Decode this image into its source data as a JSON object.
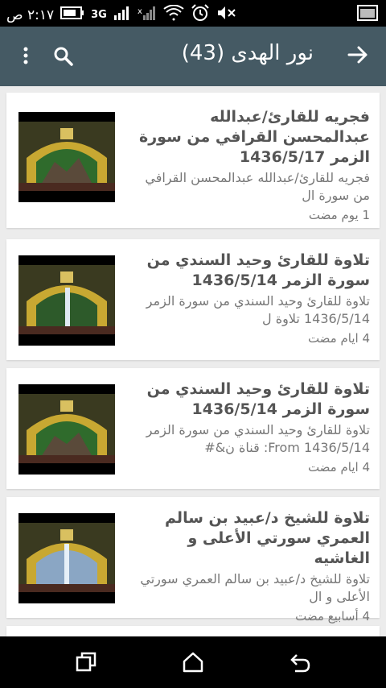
{
  "status": {
    "time": "٢:١٧ ص",
    "network_label": "3G"
  },
  "appbar": {
    "title": "نور الهدى (43)"
  },
  "items": [
    {
      "title": "فجريه للقارئ/عبدالله عبدالمحسن القرافي من سورة الزمر 1436/5/17",
      "description": "فجريه للقارئ/عبدالله عبدالمحسن القرافي من سورة ال",
      "time": "1 يوم مضت"
    },
    {
      "title": "تلاوة للقارئ وحيد السندي من سورة الزمر 1436/5/14",
      "description": "تلاوة للقارئ وحيد السندي من سورة الزمر 1436/5/14 تلاوة ل",
      "time": "4 ايام مضت"
    },
    {
      "title": "تلاوة للقارئ وحيد السندي من سورة الزمر 1436/5/14",
      "description": "تلاوة للقارئ وحيد السندي من سورة الزمر 1436/5/14 From: قناة ن&#",
      "time": "4 ايام مضت"
    },
    {
      "title": "تلاوة للشيخ د/عبيد بن سالم العمري سورتي الأعلى و الغاشيه",
      "description": "تلاوة للشيخ د/عبيد بن سالم العمري سورتي الأعلى و ال",
      "time": "4 أسابيع مضت"
    }
  ],
  "colors": {
    "appbar": "#455a64",
    "background": "#ececec",
    "card": "#ffffff",
    "statusbar": "#000000",
    "navbar": "#000000"
  },
  "icons": {
    "back": "arrow-forward-icon",
    "search": "search-icon",
    "more": "more-vert-icon",
    "nav_recents": "recents-icon",
    "nav_home": "home-icon",
    "nav_back": "back-icon"
  }
}
